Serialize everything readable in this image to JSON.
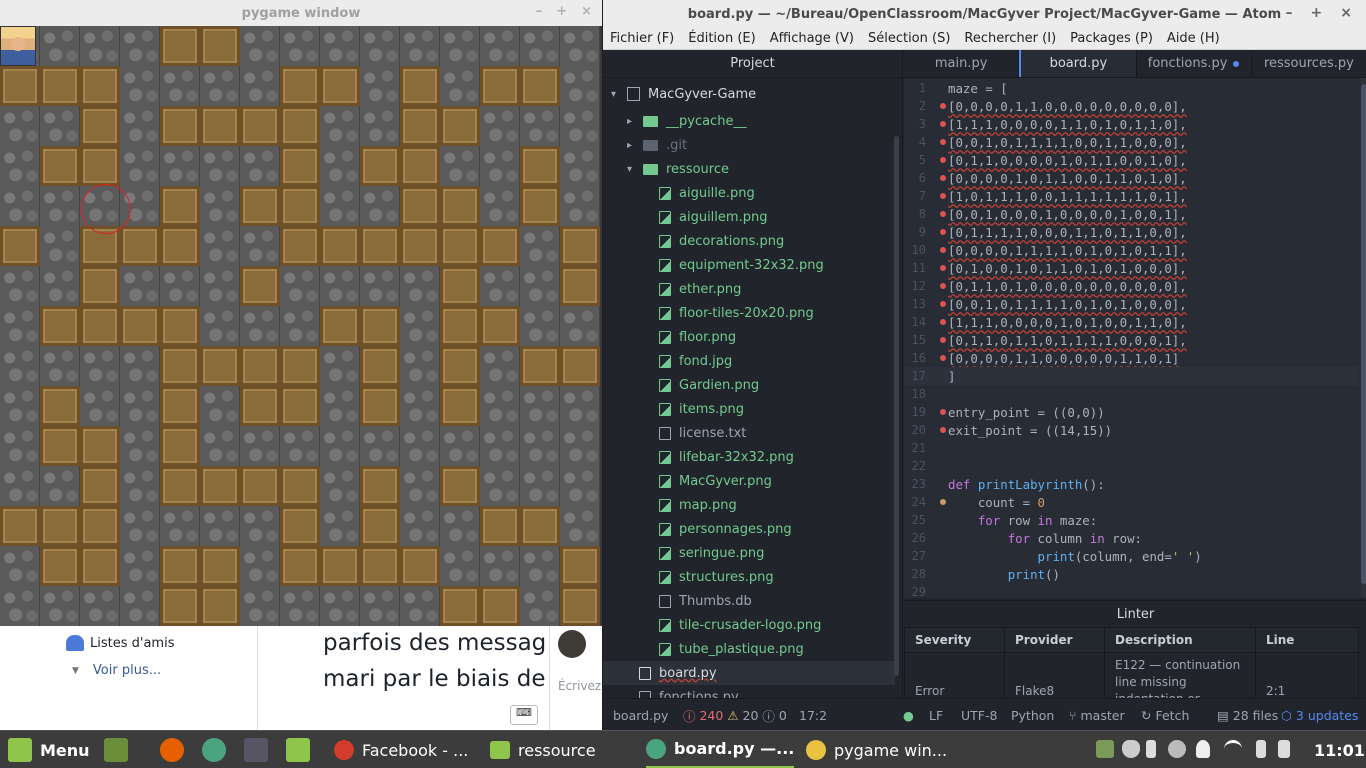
{
  "pygame": {
    "title": "pygame window",
    "buttons": [
      "–",
      "+",
      "×"
    ],
    "maze": [
      [
        0,
        0,
        0,
        0,
        1,
        1,
        0,
        0,
        0,
        0,
        0,
        0,
        0,
        0,
        0
      ],
      [
        1,
        1,
        1,
        0,
        0,
        0,
        0,
        1,
        1,
        0,
        1,
        0,
        1,
        1,
        0
      ],
      [
        0,
        0,
        1,
        0,
        1,
        1,
        1,
        1,
        0,
        0,
        1,
        1,
        0,
        0,
        0
      ],
      [
        0,
        1,
        1,
        0,
        0,
        0,
        0,
        1,
        0,
        1,
        1,
        0,
        0,
        1,
        0
      ],
      [
        0,
        0,
        0,
        0,
        1,
        0,
        1,
        1,
        0,
        0,
        1,
        1,
        0,
        1,
        0
      ],
      [
        1,
        0,
        1,
        1,
        1,
        0,
        0,
        1,
        1,
        1,
        1,
        1,
        1,
        0,
        1
      ],
      [
        0,
        0,
        1,
        0,
        0,
        0,
        1,
        0,
        0,
        0,
        0,
        1,
        0,
        0,
        1
      ],
      [
        0,
        1,
        1,
        1,
        1,
        0,
        0,
        0,
        1,
        1,
        0,
        1,
        1,
        0,
        0
      ],
      [
        0,
        0,
        0,
        0,
        1,
        1,
        1,
        1,
        0,
        1,
        0,
        1,
        0,
        1,
        1
      ],
      [
        0,
        1,
        0,
        0,
        1,
        0,
        1,
        1,
        0,
        1,
        0,
        1,
        0,
        0,
        0
      ],
      [
        0,
        1,
        1,
        0,
        1,
        0,
        0,
        0,
        0,
        0,
        0,
        0,
        0,
        0,
        0
      ],
      [
        0,
        0,
        1,
        0,
        1,
        1,
        1,
        1,
        0,
        1,
        0,
        1,
        0,
        0,
        0
      ],
      [
        1,
        1,
        1,
        0,
        0,
        0,
        0,
        1,
        0,
        1,
        0,
        0,
        1,
        1,
        0
      ],
      [
        0,
        1,
        1,
        0,
        1,
        1,
        0,
        1,
        1,
        1,
        1,
        0,
        0,
        0,
        1
      ],
      [
        0,
        0,
        0,
        0,
        1,
        1,
        0,
        0,
        0,
        0,
        0,
        1,
        1,
        0,
        1
      ]
    ]
  },
  "facebook": {
    "friends_lists": "Listes d'amis",
    "see_more": "Voir plus...",
    "post_line1": "parfois des messag",
    "post_line2": "mari par le biais de",
    "write": "Écrivez"
  },
  "atom": {
    "title": "board.py — ~/Bureau/OpenClassroom/MacGyver Project/MacGyver-Game — Atom",
    "buttons": [
      "–",
      "+",
      "×"
    ],
    "menu": [
      "Fichier (F)",
      "Édition (E)",
      "Affichage (V)",
      "Sélection (S)",
      "Rechercher (I)",
      "Packages (P)",
      "Aide (H)"
    ],
    "tree": {
      "header": "Project",
      "root": "MacGyver-Game",
      "folders": [
        "__pycache__",
        ".git",
        "ressource"
      ],
      "files": [
        "aiguille.png",
        "aiguillem.png",
        "decorations.png",
        "equipment-32x32.png",
        "ether.png",
        "floor-tiles-20x20.png",
        "floor.png",
        "fond.jpg",
        "Gardien.png",
        "items.png",
        "license.txt",
        "lifebar-32x32.png",
        "MacGyver.png",
        "map.png",
        "personnages.png",
        "seringue.png",
        "structures.png",
        "Thumbs.db",
        "tile-crusader-logo.png",
        "tube_plastique.png"
      ],
      "root_files": [
        "board.py",
        "fonctions.py"
      ]
    },
    "tabs": [
      "main.py",
      "board.py",
      "fonctions.py",
      "ressources.py"
    ],
    "code": [
      {
        "n": "1",
        "t": "maze = [",
        "dot": ""
      },
      {
        "n": "2",
        "t": "[0,0,0,0,1,1,0,0,0,0,0,0,0,0,0],",
        "dot": "red",
        "err": true
      },
      {
        "n": "3",
        "t": "[1,1,1,0,0,0,0,1,1,0,1,0,1,1,0],",
        "dot": "red",
        "err": true
      },
      {
        "n": "4",
        "t": "[0,0,1,0,1,1,1,1,0,0,1,1,0,0,0],",
        "dot": "red",
        "err": true
      },
      {
        "n": "5",
        "t": "[0,1,1,0,0,0,0,1,0,1,1,0,0,1,0],",
        "dot": "red",
        "err": true
      },
      {
        "n": "6",
        "t": "[0,0,0,0,1,0,1,1,0,0,1,1,0,1,0],",
        "dot": "red",
        "err": true
      },
      {
        "n": "7",
        "t": "[1,0,1,1,1,0,0,1,1,1,1,1,1,0,1],",
        "dot": "red",
        "err": true
      },
      {
        "n": "8",
        "t": "[0,0,1,0,0,0,1,0,0,0,0,1,0,0,1],",
        "dot": "red",
        "err": true
      },
      {
        "n": "9",
        "t": "[0,1,1,1,1,0,0,0,1,1,0,1,1,0,0],",
        "dot": "red",
        "err": true
      },
      {
        "n": "10",
        "t": "[0,0,0,0,1,1,1,1,0,1,0,1,0,1,1],",
        "dot": "red",
        "err": true
      },
      {
        "n": "11",
        "t": "[0,1,0,0,1,0,1,1,0,1,0,1,0,0,0],",
        "dot": "red",
        "err": true
      },
      {
        "n": "12",
        "t": "[0,1,1,0,1,0,0,0,0,0,0,0,0,0,0],",
        "dot": "red",
        "err": true
      },
      {
        "n": "13",
        "t": "[0,0,1,0,1,1,1,1,0,1,0,1,0,0,0],",
        "dot": "red",
        "err": true
      },
      {
        "n": "14",
        "t": "[1,1,1,0,0,0,0,1,0,1,0,0,1,1,0],",
        "dot": "red",
        "err": true
      },
      {
        "n": "15",
        "t": "[0,1,1,0,1,1,0,1,1,1,1,0,0,0,1],",
        "dot": "red",
        "err": true
      },
      {
        "n": "16",
        "t": "[0,0,0,0,1,1,0,0,0,0,0,1,1,0,1]",
        "dot": "red",
        "err": true
      },
      {
        "n": "17",
        "t": "]",
        "dot": "",
        "cur": true
      },
      {
        "n": "18",
        "t": "",
        "dot": ""
      },
      {
        "n": "19",
        "t": "entry_point = ((0,0))",
        "dot": "red"
      },
      {
        "n": "20",
        "t": "exit_point = ((14,15))",
        "dot": "red"
      },
      {
        "n": "21",
        "t": "",
        "dot": ""
      },
      {
        "n": "22",
        "t": "",
        "dot": ""
      },
      {
        "n": "23",
        "t": "def printLabyrinth():",
        "dot": ""
      },
      {
        "n": "24",
        "t": "    count = 0",
        "dot": "orange"
      },
      {
        "n": "25",
        "t": "    for row in maze:",
        "dot": ""
      },
      {
        "n": "26",
        "t": "        for column in row:",
        "dot": ""
      },
      {
        "n": "27",
        "t": "            print(column, end=' ')",
        "dot": ""
      },
      {
        "n": "28",
        "t": "        print()",
        "dot": ""
      },
      {
        "n": "29",
        "t": "",
        "dot": ""
      }
    ],
    "linter": {
      "title": "Linter",
      "headers": [
        "Severity",
        "Provider",
        "Description",
        "Line"
      ],
      "row": {
        "severity": "Error",
        "provider": "Flake8",
        "description": "E122 — continuation line missing indentation or outdented",
        "line": "2:1"
      }
    },
    "status": {
      "file": "board.py",
      "errors": "240",
      "warnings": "20",
      "infos": "0",
      "position": "17:2",
      "eol": "LF",
      "encoding": "UTF-8",
      "grammar": "Python",
      "branch": "master",
      "fetch": "Fetch",
      "files": "28 files",
      "updates": "3 updates"
    }
  },
  "taskbar": {
    "menu": "Menu",
    "windows": [
      "Facebook - ...",
      "ressource",
      "board.py —...",
      "pygame win..."
    ],
    "clock": "11:01"
  },
  "colors": {
    "wall": "#8b6b3a",
    "floor": "#5a5a5a",
    "atom_bg": "#282c34",
    "accent": "#568af2",
    "mint_green": "#8fc54a"
  }
}
